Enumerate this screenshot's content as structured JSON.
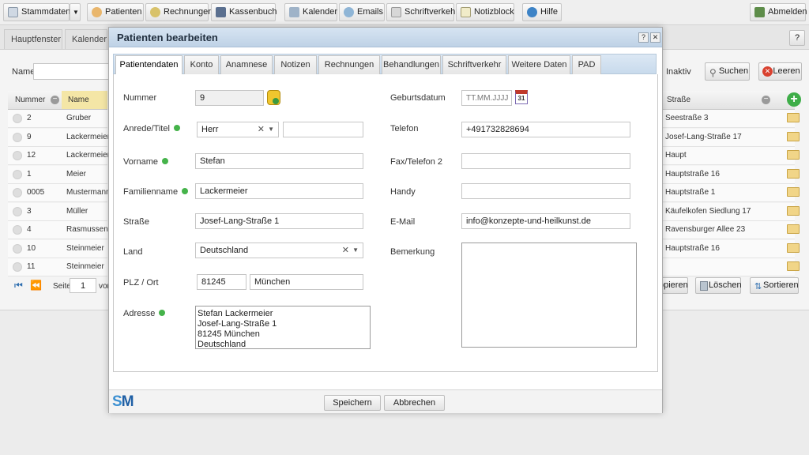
{
  "toolbar": {
    "stammdaten": "Stammdaten",
    "patienten": "Patienten",
    "rechnungen": "Rechnungen",
    "kassenbuch": "Kassenbuch",
    "kalender": "Kalender",
    "emails": "Emails",
    "schriftverkehr": "Schriftverkehr",
    "notizblock": "Notizblock",
    "hilfe": "Hilfe",
    "abmelden": "Abmelden"
  },
  "main_tabs": [
    "Hauptfenster",
    "Kalender"
  ],
  "background": {
    "name_label": "Name",
    "inaktiv_label": "Inaktiv",
    "suchen_label": "Suchen",
    "leeren_label": "Leeren",
    "columns": {
      "nummer": "Nummer",
      "name": "Name",
      "strasse": "Straße"
    },
    "rows": [
      {
        "nummer": "2",
        "name": "Gruber",
        "strasse": "Seestraße 3"
      },
      {
        "nummer": "9",
        "name": "Lackermeier",
        "strasse": "Josef-Lang-Straße 17"
      },
      {
        "nummer": "12",
        "name": "Lackermeier",
        "strasse": "Haupt"
      },
      {
        "nummer": "1",
        "name": "Meier",
        "strasse": "Hauptstraße 16"
      },
      {
        "nummer": "0005",
        "name": "Mustermann",
        "strasse": "Hauptstraße 1"
      },
      {
        "nummer": "3",
        "name": "Müller",
        "strasse": "Käufelkofen Siedlung 17"
      },
      {
        "nummer": "4",
        "name": "Rasmussen",
        "strasse": "Ravensburger Allee 23"
      },
      {
        "nummer": "10",
        "name": "Steinmeier",
        "strasse": "Hauptstraße 16"
      },
      {
        "nummer": "11",
        "name": "Steinmeier",
        "strasse": ""
      }
    ],
    "pager": {
      "seite_label": "Seite",
      "page": "1",
      "von_label": "vor"
    },
    "kopieren_label": "opieren",
    "loeschen_label": "Löschen",
    "sortieren_label": "Sortieren"
  },
  "dialog": {
    "title": "Patienten bearbeiten",
    "help": "?",
    "close": "✕",
    "tabs": [
      "Patientendaten",
      "Konto",
      "Anamnese",
      "Notizen",
      "Rechnungen",
      "Behandlungen",
      "Schriftverkehr",
      "Weitere Daten",
      "PAD"
    ],
    "labels": {
      "nummer": "Nummer",
      "anrede": "Anrede/Titel",
      "vorname": "Vorname",
      "familienname": "Familienname",
      "strasse": "Straße",
      "land": "Land",
      "plz_ort": "PLZ / Ort",
      "adresse": "Adresse",
      "geburtsdatum": "Geburtsdatum",
      "telefon": "Telefon",
      "fax": "Fax/Telefon 2",
      "handy": "Handy",
      "email": "E-Mail",
      "bemerkung": "Bemerkung"
    },
    "values": {
      "nummer": "9",
      "anrede": "Herr",
      "titel": "",
      "vorname": "Stefan",
      "familienname": "Lackermeier",
      "strasse": "Josef-Lang-Straße 1",
      "land": "Deutschland",
      "plz": "81245",
      "ort": "München",
      "adresse": "Stefan Lackermeier\nJosef-Lang-Straße 1\n81245 München\nDeutschland",
      "geburtsdatum_placeholder": "TT.MM.JJJJ",
      "telefon": "+491732828694",
      "fax": "",
      "handy": "",
      "email": "info@konzepte-und-heilkunst.de",
      "bemerkung": ""
    },
    "calendar_day": "31",
    "logo": "SM",
    "speichern": "Speichern",
    "abbrechen": "Abbrechen"
  },
  "icons": [
    "document-icon",
    "user-icon",
    "coins-icon",
    "cashbook-icon",
    "calendar-icon",
    "email-icon",
    "letter-icon",
    "notepad-icon",
    "globe-icon",
    "logout-icon",
    "lock-icon",
    "calendar-picker-icon",
    "folder-icon",
    "add-icon",
    "search-icon",
    "clear-icon",
    "trash-icon",
    "sort-icon"
  ],
  "colors": {
    "title_bar": "#c7d8ea",
    "info_dot": "#45b34a",
    "logo_blue": "#3b8fd1",
    "add_green": "#3fae49",
    "clear_red": "#d9412f"
  }
}
